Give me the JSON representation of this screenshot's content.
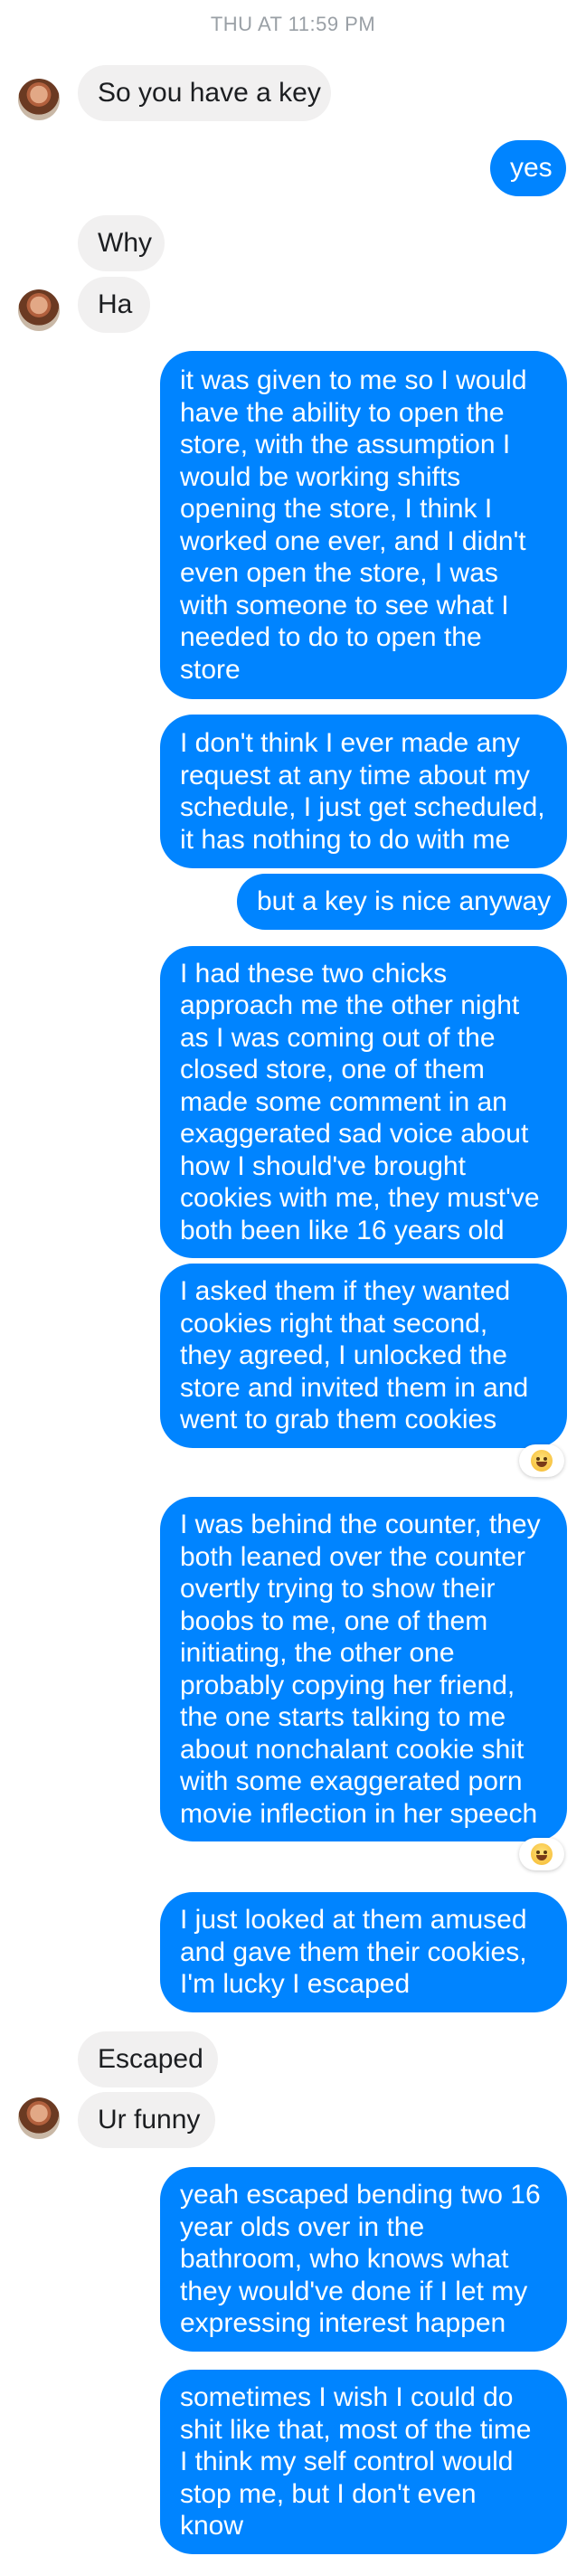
{
  "header": {
    "timestamp": "THU AT 11:59 PM"
  },
  "messages": [
    {
      "lines": [
        "So you have a key"
      ]
    },
    {
      "lines": [
        "yes"
      ]
    },
    {
      "lines": [
        "Why"
      ]
    },
    {
      "lines": [
        "Ha"
      ]
    },
    {
      "lines": [
        "it was given to me so I would",
        "have the ability to open the",
        "store, with the assumption I",
        "would be working shifts",
        "opening the store, I think I",
        "worked one ever, and I didn't",
        "even open the store, I was",
        "with someone to see what I",
        "needed to do to open the",
        "store"
      ]
    },
    {
      "lines": [
        "I don't think I ever made any",
        "request at any time about my",
        "schedule, I just get scheduled,",
        "it has nothing to do with me"
      ]
    },
    {
      "lines": [
        "but a key is nice anyway"
      ]
    },
    {
      "lines": [
        "I had these two chicks",
        "approach me the other night",
        "as I was coming out of the",
        "closed store, one of them",
        "made some comment in an",
        "exaggerated sad voice about",
        "how I should've brought",
        "cookies with me, they must've",
        "both been like 16 years old"
      ]
    },
    {
      "lines": [
        "I asked them if they wanted",
        "cookies right that second,",
        "they agreed, I unlocked the",
        "store and invited them in and",
        "went to grab them cookies"
      ]
    },
    {
      "lines": [
        "I was behind the counter, they",
        "both leaned over the counter",
        "overtly trying to show their",
        "boobs to me, one of them",
        "initiating, the other one",
        "probably copying her friend,",
        "the one starts talking to me",
        "about nonchalant cookie shit",
        "with some exaggerated porn",
        "movie inflection in her speech"
      ]
    },
    {
      "lines": [
        "I just looked at them amused",
        "and gave them their cookies,",
        "I'm lucky I escaped"
      ]
    },
    {
      "lines": [
        "Escaped"
      ]
    },
    {
      "lines": [
        "Ur funny"
      ]
    },
    {
      "lines": [
        "yeah escaped bending two 16",
        "year olds over in the",
        "bathroom, who knows what",
        "they would've done if I let my",
        "expressing interest happen"
      ]
    },
    {
      "lines": [
        "sometimes I wish I could do",
        "shit like that, most of the time",
        "I think my self control would",
        "stop me, but I don't even",
        "know"
      ]
    }
  ],
  "reactions": [
    {
      "emoji_name": "laughing-emoji"
    },
    {
      "emoji_name": "laughing-emoji"
    }
  ],
  "colors": {
    "outgoing": "#0084ff",
    "incoming": "#f1f0f0",
    "background": "#ffffff"
  }
}
